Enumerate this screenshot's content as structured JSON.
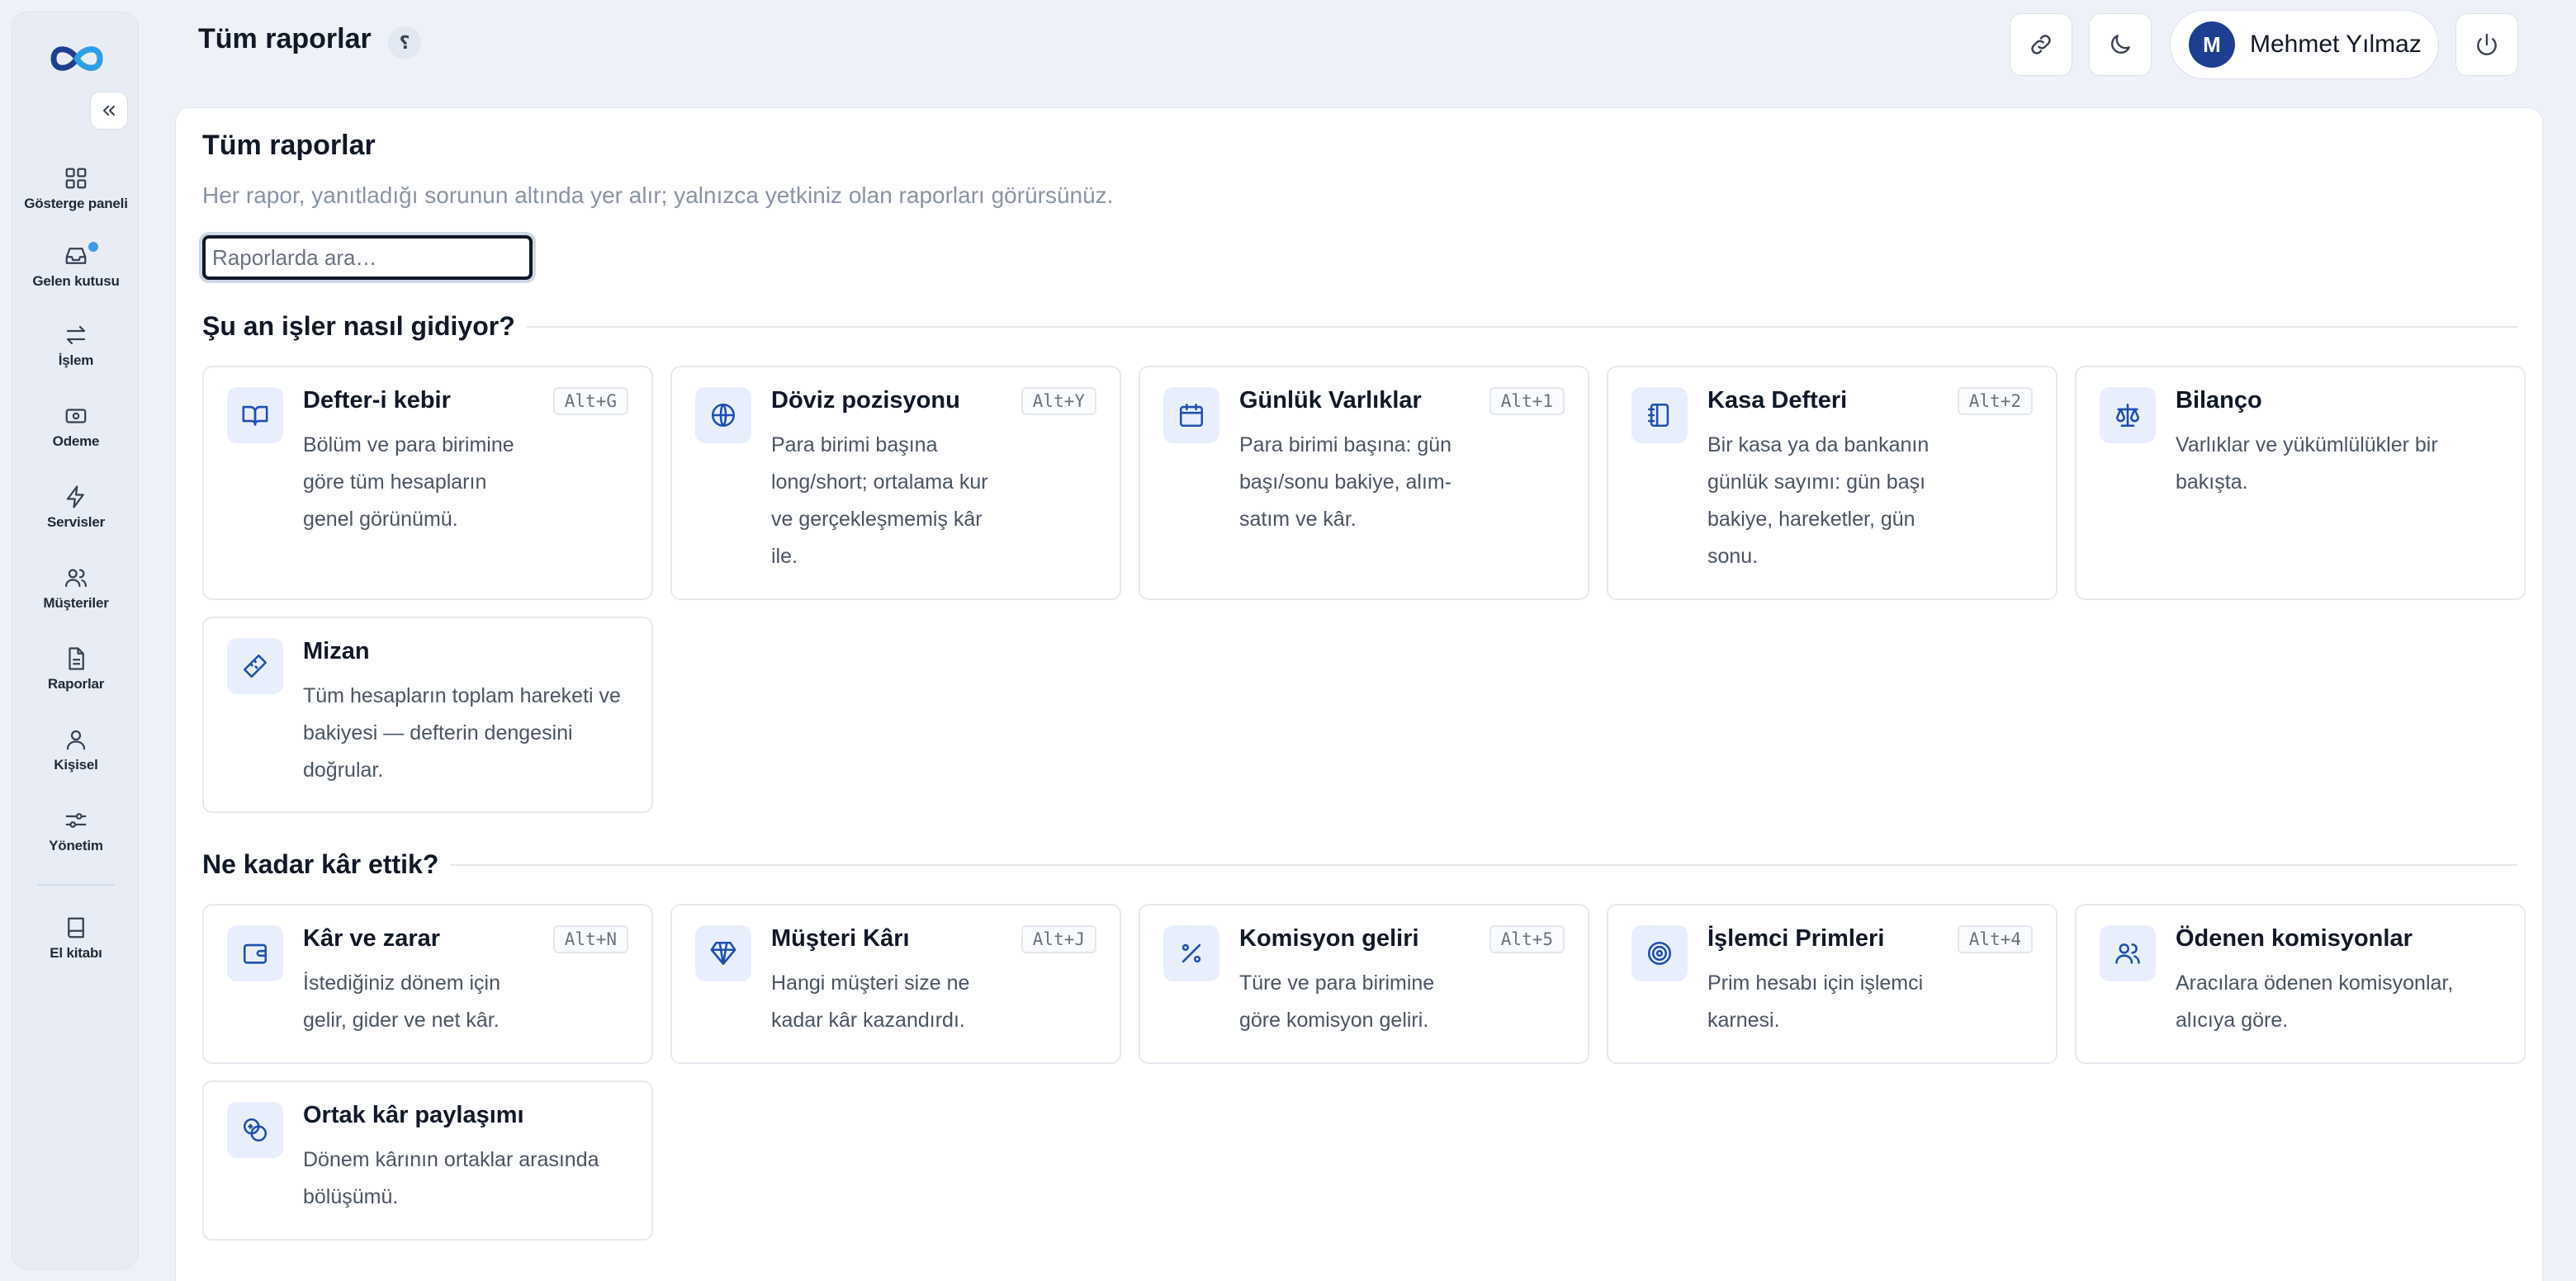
{
  "header": {
    "title": "Tüm raporlar",
    "help_glyph": "؟",
    "user": {
      "initial": "M",
      "name": "Mehmet Yılmaz"
    }
  },
  "sidebar": {
    "items": [
      {
        "label": "Gösterge paneli",
        "icon": "dashboard-icon"
      },
      {
        "label": "Gelen kutusu",
        "icon": "inbox-icon"
      },
      {
        "label": "İşlem",
        "icon": "transfer-icon"
      },
      {
        "label": "Odeme",
        "icon": "payment-icon"
      },
      {
        "label": "Servisler",
        "icon": "bolt-icon"
      },
      {
        "label": "Müşteriler",
        "icon": "users-icon"
      },
      {
        "label": "Raporlar",
        "icon": "document-icon"
      },
      {
        "label": "Kişisel",
        "icon": "user-icon"
      },
      {
        "label": "Yönetim",
        "icon": "sliders-icon"
      }
    ],
    "handbook": {
      "label": "El kitabı",
      "icon": "book-icon"
    }
  },
  "main": {
    "title": "Tüm raporlar",
    "subtitle": "Her rapor, yanıtladığı sorunun altında yer alır; yalnızca yetkiniz olan raporları görürsünüz.",
    "search_placeholder": "Raporlarda ara…",
    "sections": [
      {
        "title": "Şu an işler nasıl gidiyor?",
        "cards": [
          {
            "title": "Defter-i kebir",
            "shortcut": "Alt+G",
            "icon": "book-open-icon",
            "desc": "Bölüm ve para birimine göre tüm hesapların genel görünümü."
          },
          {
            "title": "Döviz pozisyonu",
            "shortcut": "Alt+Y",
            "icon": "globe-icon",
            "desc": "Para birimi başına long/short; ortalama kur ve gerçekleşmemiş kâr ile."
          },
          {
            "title": "Günlük Varlıklar",
            "shortcut": "Alt+1",
            "icon": "calendar-icon",
            "desc": "Para birimi başına: gün başı/sonu bakiye, alım-satım ve kâr."
          },
          {
            "title": "Kasa Defteri",
            "shortcut": "Alt+2",
            "icon": "notebook-icon",
            "desc": "Bir kasa ya da bankanın günlük sayımı: gün başı bakiye, hareketler, gün sonu."
          },
          {
            "title": "Bilanço",
            "shortcut": "",
            "icon": "scale-icon",
            "desc": "Varlıklar ve yükümlülükler bir bakışta."
          },
          {
            "title": "Mizan",
            "shortcut": "",
            "icon": "ruler-icon",
            "desc": "Tüm hesapların toplam hareketi ve bakiyesi — defterin dengesini doğrular."
          }
        ]
      },
      {
        "title": "Ne kadar kâr ettik?",
        "cards": [
          {
            "title": "Kâr ve zarar",
            "shortcut": "Alt+N",
            "icon": "wallet-icon",
            "desc": "İstediğiniz dönem için gelir, gider ve net kâr."
          },
          {
            "title": "Müşteri Kârı",
            "shortcut": "Alt+J",
            "icon": "gem-icon",
            "desc": "Hangi müşteri size ne kadar kâr kazandırdı."
          },
          {
            "title": "Komisyon geliri",
            "shortcut": "Alt+5",
            "icon": "percent-icon",
            "desc": "Türe ve para birimine göre komisyon geliri."
          },
          {
            "title": "İşlemci Primleri",
            "shortcut": "Alt+4",
            "icon": "target-icon",
            "desc": "Prim hesabı için işlemci karnesi."
          },
          {
            "title": "Ödenen komisyonlar",
            "shortcut": "",
            "icon": "people-icon",
            "desc": "Aracılara ödenen komisyonlar, alıcıya göre."
          },
          {
            "title": "Ortak kâr paylaşımı",
            "shortcut": "",
            "icon": "coins-icon",
            "desc": "Dönem kârının ortaklar arasında bölüşümü."
          }
        ]
      }
    ]
  },
  "colors": {
    "accent": "#1e4fb0",
    "background": "#eef2f8",
    "card_icon_bg": "#e8eefb",
    "notification": "#3b9be6"
  }
}
